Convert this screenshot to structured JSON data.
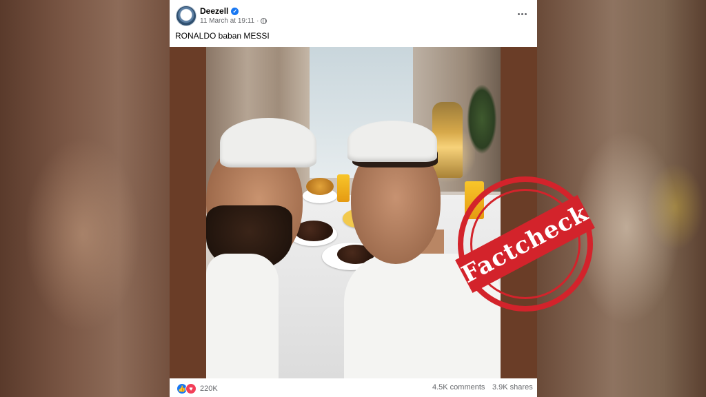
{
  "post": {
    "author": "Deezell",
    "timestamp": "11 March at 19:11",
    "caption": "RONALDO baban MESSI",
    "stamp_text": "Factcheck",
    "icons": {
      "avatar": "avatar",
      "verified": "verified-badge-icon",
      "audience": "globe-icon",
      "more": "more-options-icon",
      "like": "like-icon",
      "love": "love-icon"
    }
  },
  "footer": {
    "reaction_count": "220K",
    "comments": "4.5K comments",
    "shares": "3.9K shares"
  },
  "colors": {
    "accent_blue": "#1877f2",
    "love_red": "#f33e58",
    "stamp_red": "#d3232b",
    "frame_brown": "#6a3d27"
  }
}
